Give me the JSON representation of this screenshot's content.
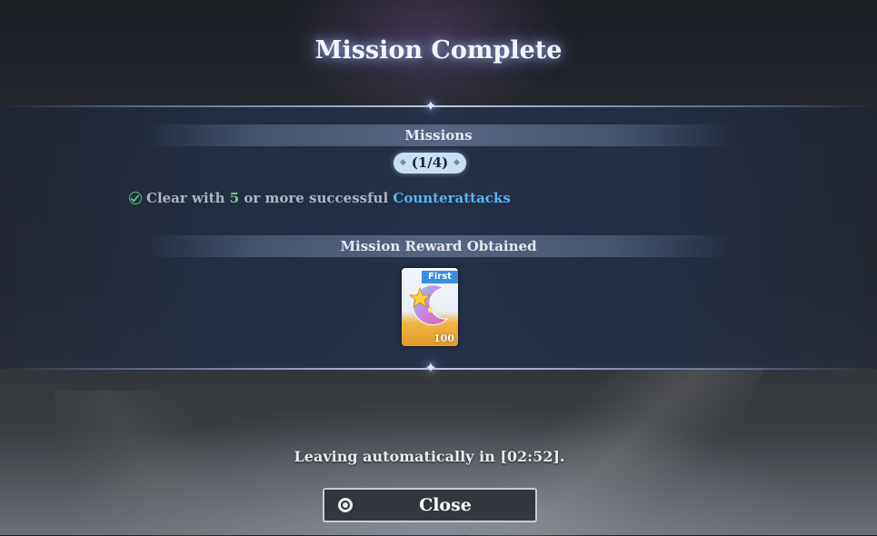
{
  "screen": {
    "title": "Mission Complete"
  },
  "missions": {
    "header": "Missions",
    "progress": "(1/4)",
    "items": [
      {
        "status": "completed",
        "text_before": "Clear with ",
        "count": "5",
        "text_middle": " or more successful ",
        "keyword": "Counterattacks"
      }
    ]
  },
  "reward": {
    "header": "Mission Reward Obtained",
    "items": [
      {
        "icon": "crescent-moon-star-icon",
        "tag": "First",
        "quantity": "100"
      }
    ]
  },
  "footer": {
    "leaving_text": "Leaving automatically in [02:52].",
    "close_label": "Close"
  },
  "colors": {
    "check": "#57c08a",
    "count": "#6ccf8f",
    "keyword": "#58b4f0",
    "tag": "#3a8fe0"
  }
}
